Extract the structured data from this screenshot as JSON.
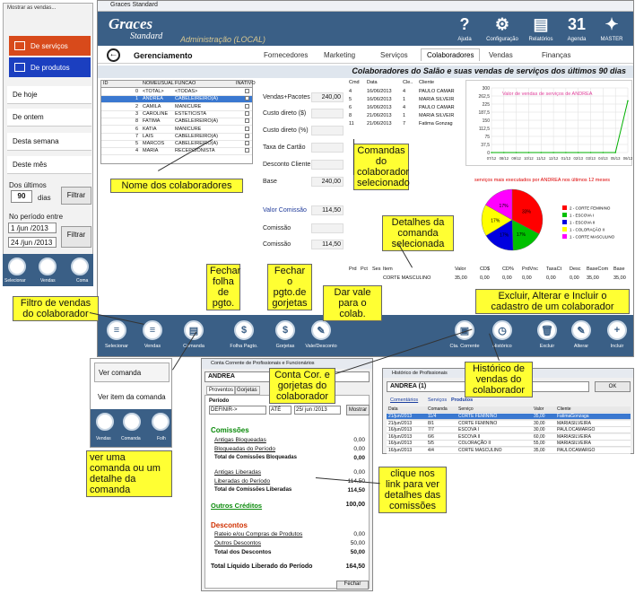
{
  "left_panel": {
    "caption": "Mostrar as vendas...",
    "btn_servicos": "De serviços",
    "btn_produtos": "De produtos",
    "items": [
      "De hoje",
      "De ontem",
      "Desta semana",
      "Deste mês"
    ],
    "dos_ultimos": "Dos últimos",
    "days_value": "90",
    "dias": "dias",
    "filtrar": "Filtrar",
    "periodo_label": "No período entre",
    "date1": "1 /jun /2013",
    "date2": "24 /jun /2013",
    "bottom_icons": [
      "Selecionar",
      "Vendas",
      "Coma"
    ]
  },
  "main": {
    "window_title": "Graces Standard",
    "brand_main": "Graces",
    "brand_sub": "Standard",
    "admin": "Administração (LOCAL)",
    "top_icons": [
      {
        "icon": "help-icon",
        "glyph": "?",
        "label": "Ajuda"
      },
      {
        "icon": "gear-icon",
        "glyph": "⚙",
        "label": "Configuração"
      },
      {
        "icon": "printer-icon",
        "glyph": "▤",
        "label": "Relatórios"
      },
      {
        "icon": "calendar-icon",
        "glyph": "31",
        "label": "Agenda"
      },
      {
        "icon": "master-icon",
        "glyph": "✦",
        "label": "MASTER"
      }
    ],
    "nav_title": "Gerenciamento",
    "tabs": [
      "Fornecedores",
      "Marketing",
      "Serviços",
      "Colaboradores",
      "Vendas",
      "Finanças"
    ],
    "subtitle": "Colaboradores do Salão e suas vendas de serviços dos últimos 90 dias",
    "table_headers": [
      "ID",
      "NOMEUSUAL",
      "FUNCAO",
      "INATIVO"
    ],
    "table_rows": [
      [
        "0",
        "<TOTAL>",
        "<TODAS>"
      ],
      [
        "1",
        "ANDREA",
        "CABELEIREIRO(A)"
      ],
      [
        "2",
        "CAMILA",
        "MANICURE"
      ],
      [
        "3",
        "CAROLINE",
        "ESTETICISTA"
      ],
      [
        "8",
        "FATIMA",
        "CABELEIREIRO(A)"
      ],
      [
        "6",
        "KATIA",
        "MANICURE"
      ],
      [
        "7",
        "LAIS",
        "CABELEIREIRO(A)"
      ],
      [
        "5",
        "MARCOS",
        "CABELEIREIRO(A)"
      ],
      [
        "4",
        "MARIA",
        "RECEPCIONISTA"
      ]
    ],
    "fields": [
      {
        "label": "Vendas+Pacotes",
        "value": "240,00"
      },
      {
        "label": "Custo direto ($)",
        "value": ""
      },
      {
        "label": "Custo direto (%)",
        "value": ""
      },
      {
        "label": "Taxa de Cartão",
        "value": ""
      },
      {
        "label": "Desconto Cliente",
        "value": ""
      },
      {
        "label": "Base",
        "value": "240,00"
      },
      {
        "label": "Valor Comissão",
        "value": "114,50"
      },
      {
        "label": "Comissão",
        "value": ""
      },
      {
        "label": "Comissão",
        "value": "114,50"
      }
    ],
    "comandas_headers": [
      "Cmd",
      "Data",
      "Cle..",
      "Cliente"
    ],
    "comandas_rows": [
      [
        "4",
        "16/06/2013",
        "4",
        "PAULO CAMAR"
      ],
      [
        "5",
        "16/06/2013",
        "1",
        "MARIA SILVEIR"
      ],
      [
        "6",
        "16/06/2013",
        "4",
        "PAULO CAMAR"
      ],
      [
        "8",
        "21/06/2013",
        "1",
        "MARIA SILVEIR"
      ],
      [
        "11",
        "21/06/2013",
        "7",
        "Fatima Gonzag"
      ]
    ],
    "detail_headers": [
      "Prd",
      "Pct",
      "Ses",
      "Item",
      "Valor",
      "CD$",
      "CD%",
      "PrdVnc",
      "TaxaCt",
      "Desc",
      "BaseCom",
      "Base"
    ],
    "detail_row": [
      "",
      "",
      "",
      "CORTE MASCULINO",
      "35,00",
      "0,00",
      "0,00",
      "0,00",
      "0,00",
      "0,00",
      "35,00",
      "35,00"
    ],
    "toolbar": [
      "Selecionar",
      "Vendas",
      "Comanda",
      "Folha Pagto.",
      "Gorjetas",
      "Vale/Desconto",
      "Cta. Corrente",
      "Histórico",
      "Excluir",
      "Alterar",
      "Incluir"
    ]
  },
  "chart_data": [
    {
      "type": "line",
      "title": "Valor de vendas de serviços de ANDREA",
      "categories": [
        "07/12",
        "08/12",
        "09/12",
        "10/12",
        "11/12",
        "12/12",
        "01/13",
        "02/13",
        "03/13",
        "04/13",
        "05/13",
        "06/13"
      ],
      "values": [
        0,
        0,
        0,
        0,
        0,
        0,
        0,
        0,
        0,
        0,
        0,
        240
      ],
      "ylim": [
        0,
        300
      ],
      "yticks": [
        "300",
        "262,5",
        "225",
        "187,5",
        "150",
        "112,5",
        "75",
        "37,5",
        "0"
      ]
    },
    {
      "type": "pie",
      "title": "serviços mais executados por ANDREA nos últimos 12 meses",
      "slices": [
        {
          "label": "2 - CORTE FEMININO",
          "value": 33,
          "color": "#ff0000",
          "pct": "33%"
        },
        {
          "label": "1 - ESCOVA I",
          "value": 17,
          "color": "#00c000",
          "pct": "17%"
        },
        {
          "label": "1 - ESCOVA II",
          "value": 17,
          "color": "#0000e0",
          "pct": "17%"
        },
        {
          "label": "1 - COLORAÇÃO II",
          "value": 17,
          "color": "#ffff00",
          "pct": "17%"
        },
        {
          "label": "1 - CORTE MASCULINO",
          "value": 17,
          "color": "#ff00ff",
          "pct": "17%"
        }
      ]
    }
  ],
  "menu": {
    "ver_comanda": "Ver comanda",
    "ver_item": "Ver item da comanda",
    "icons": [
      "Vendas",
      "Comanda",
      "Folh"
    ]
  },
  "conta": {
    "title": "Conta Corrente de Profissionais e Funcionários",
    "name": "ANDREA",
    "tabs": [
      "Proventos",
      "Gorjetas"
    ],
    "periodo": "Período",
    "definir": "DEFINIR->",
    "ate": "ATÉ",
    "date": "25/ jun /2013",
    "mostrar": "Mostrar",
    "comissoes": "Comissões",
    "rows1": [
      [
        "Antigas Bloqueadas",
        "0,00"
      ],
      [
        "Bloqueadas do Período",
        "0,00"
      ],
      [
        "Total de Comissões Bloqueadas",
        "0,00"
      ]
    ],
    "rows2": [
      [
        "Antigas Liberadas",
        "0,00"
      ],
      [
        "Liberadas do Período",
        "114,50"
      ],
      [
        "Total de Comissões Liberadas",
        "114,50"
      ]
    ],
    "outros_label": "Outros Créditos",
    "outros_value": "100,00",
    "descontos": "Descontos",
    "rows3": [
      [
        "Rateio e/ou Compras de Produtos",
        "0,00"
      ],
      [
        "Outros Descontos",
        "50,00"
      ],
      [
        "Total dos Descontos",
        "50,00"
      ]
    ],
    "total_label": "Total Líquido Liberado do Período",
    "total_value": "164,50",
    "fechar": "Fechar"
  },
  "hist": {
    "title": "Histórico de Profissionais",
    "name": "ANDREA  (1)",
    "ok": "OK",
    "tabs": [
      "Comentários",
      "Serviços",
      "Produtos"
    ],
    "headers": [
      "Data",
      "Comanda",
      "Serviço",
      "Valor",
      "Cliente"
    ],
    "rows": [
      [
        "21/jun/2013",
        "11/4",
        "CORTE FEMININO",
        "35,00",
        "FatimaGonzaga"
      ],
      [
        "21/jun/2013",
        "8/1",
        "CORTE FEMININO",
        "30,00",
        "MARIASILVEIRA"
      ],
      [
        "16/jun/2013",
        "7/7",
        "ESCOVA I",
        "30,00",
        "PAULOCAMARGO"
      ],
      [
        "16/jun/2013",
        "6/6",
        "ESCOVA II",
        "60,00",
        "MARIASILVEIRA"
      ],
      [
        "16/jun/2013",
        "5/5",
        "COLORAÇÃO II",
        "55,00",
        "MARIASILVEIRA"
      ],
      [
        "16/jun/2013",
        "4/4",
        "CORTE MASCULINO",
        "35,00",
        "PAULOCAMARGO"
      ]
    ]
  },
  "callouts": {
    "nome": "Nome dos colaboradores",
    "comandas": "Comandas do colaborador selecionado",
    "detalhes": "Detalhes da comanda selecionada",
    "filtro": "Filtro de vendas do colaborador",
    "folha": "Fechar folha de pgto.",
    "gorjetas": "Fechar o pgto.de gorjetas",
    "vale": "Dar vale para o colab.",
    "excluir": "Excluir, Alterar e Incluir o cadastro de um colaborador",
    "conta": "Conta Cor. e gorjetas do colaborador",
    "historico": "Histórico de vendas do colaborador",
    "vercomanda": "ver uma comanda ou um detalhe da comanda",
    "clique": "clique nos link para ver detalhes das comissões"
  }
}
